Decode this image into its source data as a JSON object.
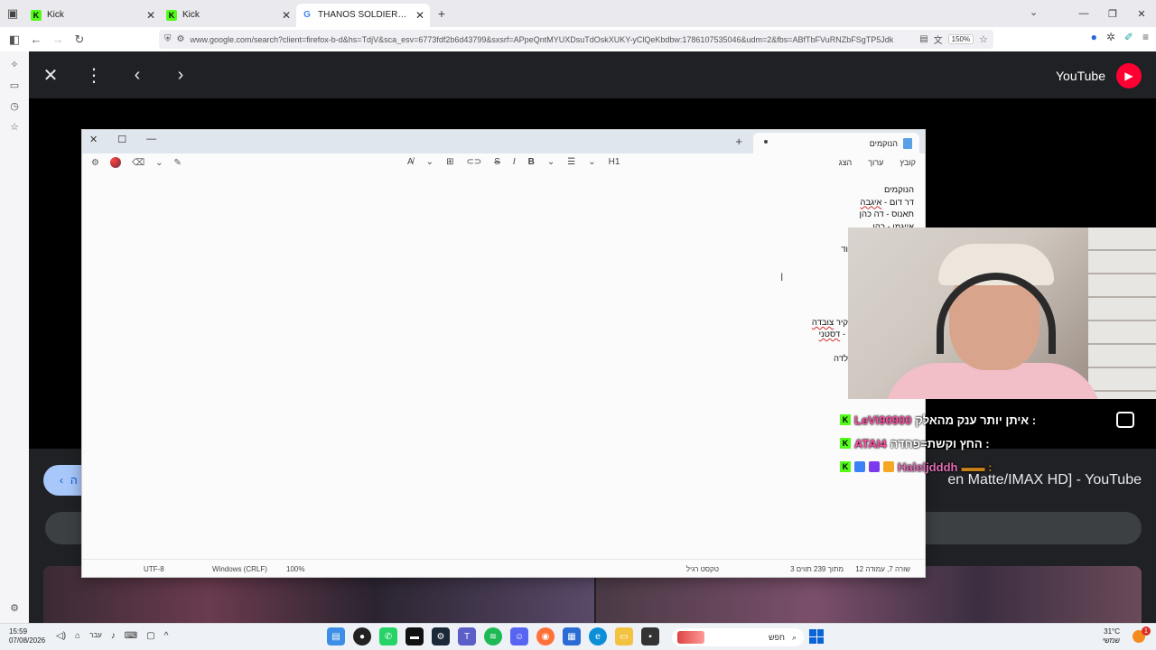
{
  "browser": {
    "tabs": [
      {
        "title": "Kick",
        "favicon": "kick-favicon-icon",
        "active": false
      },
      {
        "title": "Kick",
        "favicon": "kick-favicon-icon",
        "active": false
      },
      {
        "title": "THANOS SOLDIERS - חיפוש ב-G",
        "favicon": "google-favicon-icon",
        "active": true
      }
    ],
    "url": "www.google.com/search?client=firefox-b-d&hs=TdjV&sca_esv=6773fdf2b6d43799&sxsrf=APpeQntMYUXDsuTdOskXUKY-yClQeKbdbw:1786107535046&udm=2&fbs=ABfTbFVuRNZbFSgTP5Jdk",
    "zoom": "150%"
  },
  "viewer": {
    "source_label": "YouTube",
    "video_title": "en Matte/IMAX HD] - YouTube",
    "back_pill_label": "ה"
  },
  "notepad": {
    "tab_title": "הנוקמים",
    "menu": [
      "קובץ",
      "ערוך",
      "הצג"
    ],
    "heading_label": "H1",
    "bold_label": "B",
    "italic_label": "I",
    "lines": [
      {
        "text": "הנוקמים",
        "underline": ""
      },
      {
        "text": "דר דום - ",
        "underline": "איגבה"
      },
      {
        "text": "תאנוס - דה כהן",
        "underline": ""
      },
      {
        "text": "אייגמן - כהן",
        "underline": ""
      }
    ],
    "fragments": {
      "frag1": "וד",
      "frag2a": "קיר ",
      "frag2b": "צובדה",
      "frag3a": "- ",
      "frag3b": "דסטני",
      "frag4": "לדה"
    },
    "status": {
      "position": "שורה 7, עמודה 12",
      "chars": "3 מתוך 239 תווים",
      "format": "טקסט רגיל",
      "zoom": "100%",
      "line_ending": "Windows (CRLF)",
      "encoding": "UTF-8"
    }
  },
  "chat": [
    {
      "user": "LeVi90900",
      "user_color": "#ff4fa3",
      "message": ": איתן יותר ענק מהאלק"
    },
    {
      "user": "ATAI4",
      "user_color": "#ff4fa3",
      "message": ": החץ וקשת=פחדה"
    },
    {
      "user": "Haleljdddh",
      "user_color": "#e26bb6",
      "message": ": ▬▬"
    }
  ],
  "taskbar": {
    "time": "15:59",
    "date": "07/08/2026",
    "lang": "עבר",
    "search_placeholder": "חפש",
    "temperature": "31°C",
    "weather_desc": "שמשי",
    "notif_count": "1"
  },
  "colors": {
    "kick_green": "#53fc18",
    "youtube_red": "#ff0033",
    "pill_blue": "#a8c7fa"
  }
}
